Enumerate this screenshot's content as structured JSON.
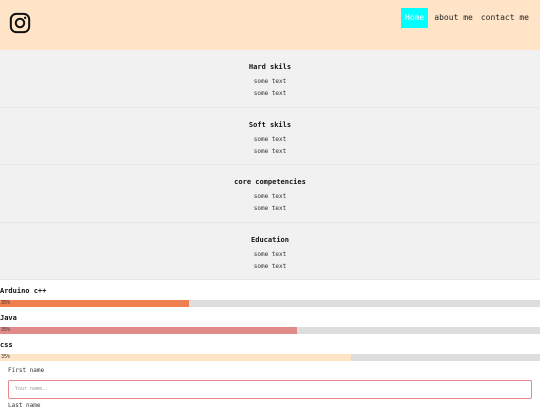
{
  "header": {
    "logo_icon": "instagram-icon",
    "nav": [
      {
        "label": "Home",
        "active": true
      },
      {
        "label": "about me",
        "active": false
      },
      {
        "label": "contact me",
        "active": false
      }
    ]
  },
  "sections": [
    {
      "title": "Hard skils",
      "lines": [
        "some text",
        "some text"
      ]
    },
    {
      "title": "Soft skils",
      "lines": [
        "some text",
        "some text"
      ]
    },
    {
      "title": "core competencies",
      "lines": [
        "some text",
        "some text"
      ]
    },
    {
      "title": "Education",
      "lines": [
        "some text",
        "some text"
      ]
    }
  ],
  "skills": [
    {
      "name": "Arduino c++",
      "label": "35%",
      "level": 0.35,
      "color": "#f07f50"
    },
    {
      "name": "Java",
      "label": "35%",
      "level": 0.55,
      "color": "#e08a8a"
    },
    {
      "name": "css",
      "label": "35%",
      "level": 0.65,
      "color": "#ffe4c7"
    }
  ],
  "form": {
    "first_name_label": "First name",
    "first_name_placeholder": "Your name..",
    "last_name_label": "Last name"
  },
  "colors": {
    "header_bg": "#ffe4c7",
    "nav_active": "#00ffff",
    "section_bg": "#f1f1f1"
  }
}
